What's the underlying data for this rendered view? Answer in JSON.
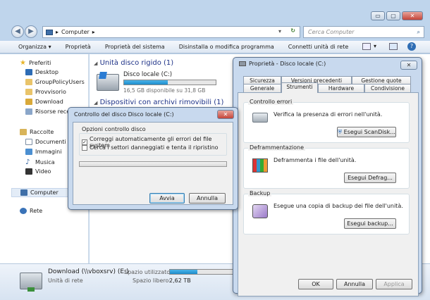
{
  "window_controls": {
    "minimize": "▭",
    "maximize": "▢",
    "close": "✕"
  },
  "address": {
    "path_icon": "computer-icon",
    "path": "Computer",
    "search_placeholder": "Cerca Computer"
  },
  "toolbar": {
    "items": [
      "Organizza ▾",
      "Proprietà",
      "Proprietà del sistema",
      "Disinstalla o modifica programma",
      "Connetti unità di rete",
      "»"
    ]
  },
  "nav": {
    "favorites": "Preferiti",
    "fav_items": [
      "Desktop",
      "GroupPolicyUsers",
      "Provvisorio",
      "Download",
      "Risorse recenti"
    ],
    "collections": "Raccolte",
    "lib_items": [
      "Documenti",
      "Immagini",
      "Musica",
      "Video"
    ],
    "computer": "Computer",
    "network": "Rete"
  },
  "content": {
    "hdd_header": "Unità disco rigido (1)",
    "drive_name": "Disco locale (C:)",
    "drive_space": "16,5 GB disponibile su 31,8 GB",
    "drive_used_fraction": 0.48,
    "removable_header": "Dispositivi con archivi rimovibili (1)"
  },
  "details": {
    "name": "Download (\\\\vboxsrv) (E:)",
    "type": "Unità di rete",
    "used_label": "Spazio utilizzato:",
    "free_label": "Spazio libero:",
    "free_value": "2,62 TB",
    "used_fraction": 0.42
  },
  "chkdsk": {
    "title": "Controllo del disco Disco locale (C:)",
    "group": "Opzioni controllo disco",
    "opt1": "Correggi automaticamente gli errori del file system",
    "opt1_checked": "✓",
    "opt2": "Cerca i settori danneggiati e tenta il ripristino",
    "start": "Avvia",
    "cancel": "Annulla"
  },
  "props": {
    "title": "Proprietà - Disco locale (C:)",
    "tabs_row1": [
      "Sicurezza",
      "Versioni precedenti",
      "Gestione quote"
    ],
    "tabs_row2": [
      "Generale",
      "Strumenti",
      "Hardware",
      "Condivisione"
    ],
    "check_group": "Controllo errori",
    "check_text": "Verifica la presenza di errori nell'unità.",
    "check_button": "Esegui ScanDisk...",
    "defrag_group": "Deframmentazione",
    "defrag_text": "Deframmenta i file dell'unità.",
    "defrag_button": "Esegui Defrag...",
    "backup_group": "Backup",
    "backup_text": "Esegue una copia di backup dei file dell'unità.",
    "backup_button": "Esegui backup...",
    "ok": "OK",
    "cancel": "Annulla",
    "apply": "Applica"
  },
  "colors": {
    "accent": "#2b7cd3",
    "title_bar": "#c8d9ee",
    "bar_fill": "#26a0da",
    "close_red": "#c4453a"
  }
}
